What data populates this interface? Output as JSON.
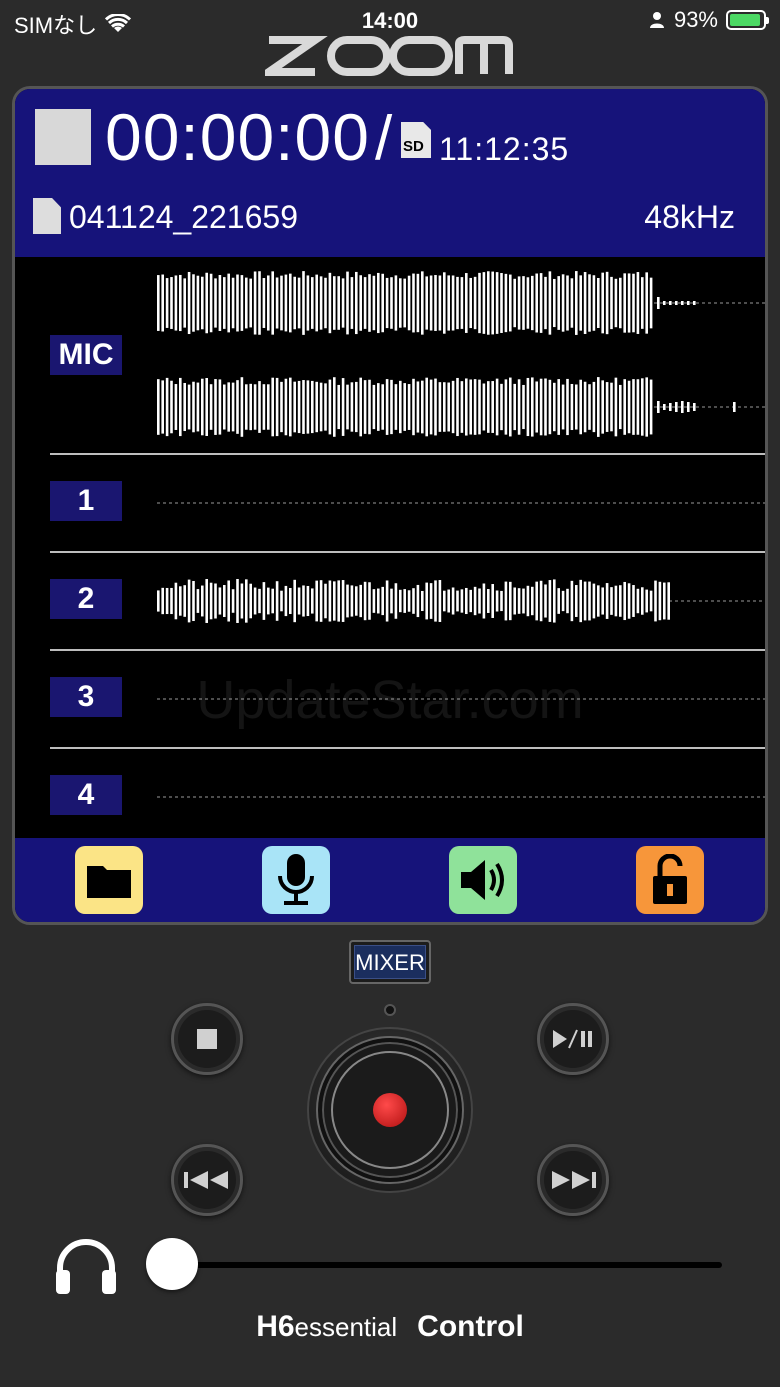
{
  "status_bar": {
    "carrier": "SIMなし",
    "time": "14:00",
    "battery": "93%",
    "battery_level": 0.93
  },
  "brand": {
    "logo_icon": "zoom-logo"
  },
  "display": {
    "elapsed": "00:00:00",
    "separator": "/",
    "storage_icon": "sd-card-icon",
    "storage_badge": "SD",
    "remaining": "11:12:35",
    "file_icon": "file-icon",
    "filename": "041124_221659",
    "sample_rate": "48kHz",
    "colors": {
      "header": "#16137a",
      "label": "#1a1670"
    },
    "tracks": [
      {
        "label": "MIC",
        "has_audio": true,
        "stereo": true
      },
      {
        "label": "1",
        "has_audio": false,
        "stereo": false
      },
      {
        "label": "2",
        "has_audio": true,
        "stereo": false
      },
      {
        "label": "3",
        "has_audio": false,
        "stereo": false
      },
      {
        "label": "4",
        "has_audio": false,
        "stereo": false
      }
    ],
    "watermark": "UpdateStar.com"
  },
  "toolbar": [
    {
      "icon": "folder-icon",
      "color": "#fbe486"
    },
    {
      "icon": "microphone-icon",
      "color": "#a9e4f7"
    },
    {
      "icon": "speaker-icon",
      "color": "#8fe29a"
    },
    {
      "icon": "unlock-icon",
      "color": "#f7963a"
    }
  ],
  "controls": {
    "mixer_label": "MIXER",
    "stop_icon": "stop-icon",
    "play_pause_icon": "play-pause-icon",
    "rewind_icon": "rewind-icon",
    "fast_forward_icon": "fast-forward-icon",
    "record_icon": "record-icon",
    "headphone_icon": "headphones-icon",
    "headphone_volume": 0.0
  },
  "product": {
    "model": "H6",
    "edition": "essential",
    "app": "Control"
  }
}
